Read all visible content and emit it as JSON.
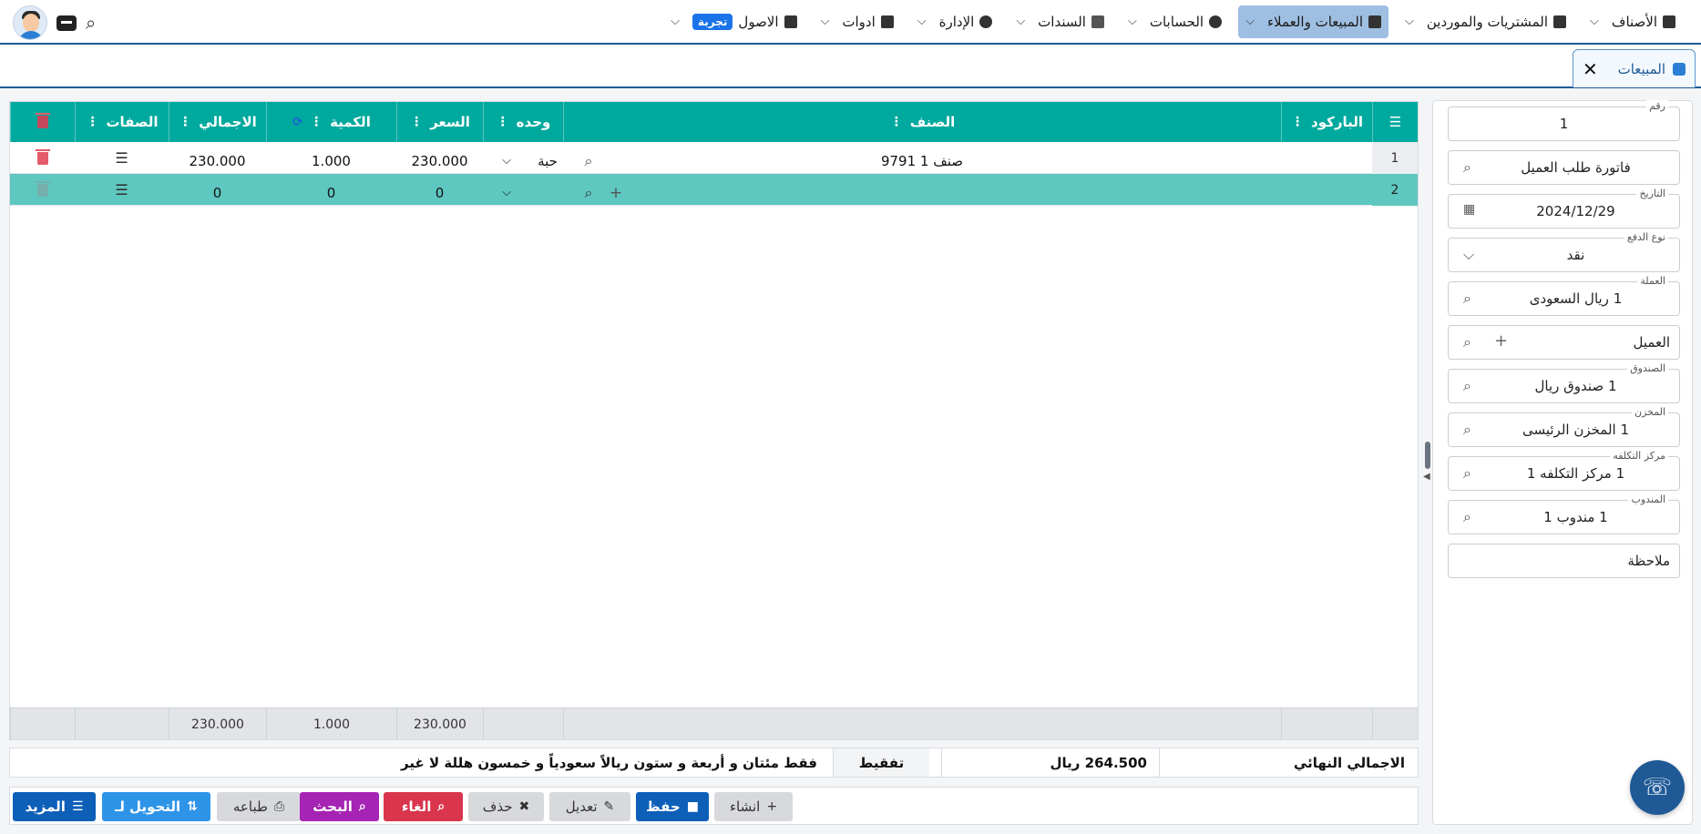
{
  "nav": {
    "items": [
      {
        "label": "الأصناف",
        "icon": "gift-icon"
      },
      {
        "label": "المشتريات والموردين",
        "icon": "lock-icon"
      },
      {
        "label": "المبيعات والعملاء",
        "icon": "register-icon"
      },
      {
        "label": "الحسابات",
        "icon": "coins-icon"
      },
      {
        "label": "السندات",
        "icon": "document-icon"
      },
      {
        "label": "الإدارة",
        "icon": "user-lock-icon"
      },
      {
        "label": "ادوات",
        "icon": "tools-icon"
      },
      {
        "label": "الاصول",
        "icon": "warehouse-icon"
      }
    ],
    "trial_badge": "تجربة"
  },
  "tab": {
    "label": "المبيعات"
  },
  "form": {
    "number": {
      "label": "رقم",
      "value": "1"
    },
    "doc_type": {
      "value": "فاتورة طلب العميل"
    },
    "date": {
      "label": "التاريخ",
      "value": "2024/12/29"
    },
    "payment_type": {
      "label": "نوع الدفع",
      "value": "نقد"
    },
    "currency": {
      "label": "العملة",
      "value": "1 ريال السعودى"
    },
    "customer": {
      "placeholder": "العميل"
    },
    "cashbox": {
      "label": "الصندوق",
      "value": "1 صندوق ريال"
    },
    "warehouse": {
      "label": "المخزن",
      "value": "1 المخزن الرئيسى"
    },
    "cost_center": {
      "label": "مركز التكلفه",
      "value": "1 مركز التكلفه 1"
    },
    "rep": {
      "label": "المندوب",
      "value": "1 مندوب 1"
    },
    "note": {
      "placeholder": "ملاحظة"
    }
  },
  "grid": {
    "columns": {
      "barcode": "الباركود",
      "item": "الصنف",
      "unit": "وحده",
      "price": "السعر",
      "qty": "الكمية",
      "total": "الاجمالي",
      "actions": "الصفات"
    },
    "rows": [
      {
        "num": "1",
        "barcode": "",
        "item": "9791 صنف 1",
        "unit": "حبة",
        "price": "230.000",
        "qty": "1.000",
        "total": "230.000"
      },
      {
        "num": "2",
        "barcode": "",
        "item": "",
        "unit": "",
        "price": "0",
        "qty": "0",
        "total": "0"
      }
    ],
    "footer": {
      "price": "230.000",
      "qty": "1.000",
      "total": "230.000"
    }
  },
  "totals": {
    "label": "الاجمالي النهائي",
    "amount": "264.500 ريال",
    "tafqit_label": "تفقيط",
    "tafqit_text": "فقط مئتان و أربعة و ستون ريالاً سعودياً و خمسون هللة لا غير"
  },
  "actions": {
    "create": "انشاء",
    "save": "حفظ",
    "edit": "تعديل",
    "delete": "حذف",
    "cancel": "الغاء",
    "search": "البحث",
    "print": "طباعه",
    "convert": "التحويل لـ",
    "more": "المزيد"
  },
  "colors": {
    "header_teal": "#00a99d",
    "selected_row": "#5ec7c0",
    "primary_blue": "#0d5fb8",
    "cancel_red": "#d9354c",
    "search_purple": "#a524b3",
    "convert_blue": "#2e94e8"
  }
}
